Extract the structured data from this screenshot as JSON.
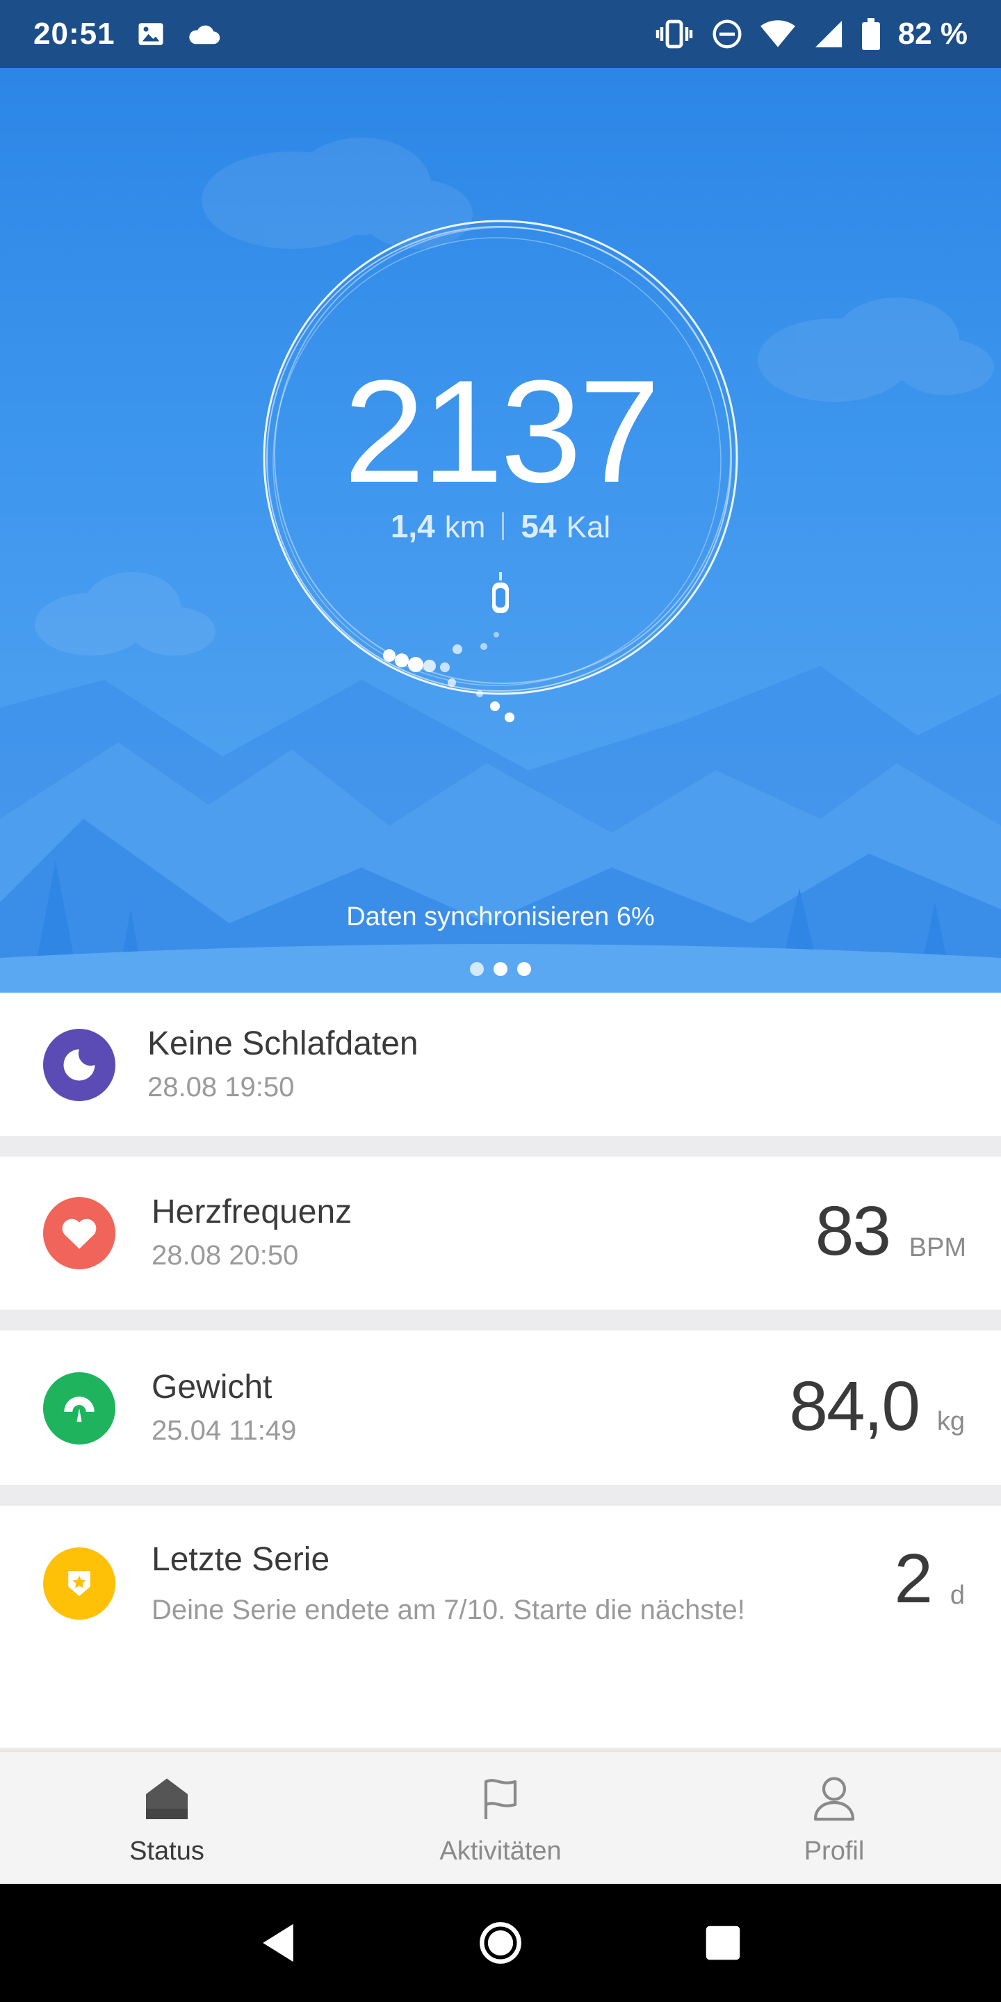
{
  "status_bar": {
    "time": "20:51",
    "battery": "82 %",
    "icons_left": [
      "image-icon",
      "cloud-icon"
    ],
    "icons_right": [
      "vibrate-icon",
      "dnd-icon",
      "wifi-icon",
      "signal-icon",
      "battery-icon"
    ]
  },
  "hero": {
    "steps": "2137",
    "distance_value": "1,4",
    "distance_unit": "km",
    "calories_value": "54",
    "calories_unit": "Kal",
    "sync_text": "Daten synchronisieren 6%",
    "page_count": 3
  },
  "cards": {
    "sleep": {
      "title": "Keine Schlafdaten",
      "subtitle": "28.08 19:50",
      "icon": "moon-icon",
      "color": "#5b4bb5"
    },
    "heart": {
      "title": "Herzfrequenz",
      "subtitle": "28.08 20:50",
      "value": "83",
      "unit": "BPM",
      "icon": "heart-icon",
      "color": "#f1645a"
    },
    "weight": {
      "title": "Gewicht",
      "subtitle": "25.04 11:49",
      "value": "84,0",
      "unit": "kg",
      "icon": "scale-icon",
      "color": "#1fb35e"
    },
    "streak": {
      "title": "Letzte Serie",
      "subtitle": "Deine Serie endete am 7/10. Starte die nächste!",
      "value": "2",
      "unit": "d",
      "icon": "medal-icon",
      "color": "#ffc107"
    }
  },
  "bottom_nav": {
    "items": [
      {
        "label": "Status",
        "icon": "home-icon",
        "active": true
      },
      {
        "label": "Aktivitäten",
        "icon": "flag-icon",
        "active": false
      },
      {
        "label": "Profil",
        "icon": "person-icon",
        "active": false
      }
    ]
  },
  "colors": {
    "status_bar": "#1c4f8a",
    "hero_top": "#2c86e6",
    "hero_bottom": "#5aa8f1"
  }
}
